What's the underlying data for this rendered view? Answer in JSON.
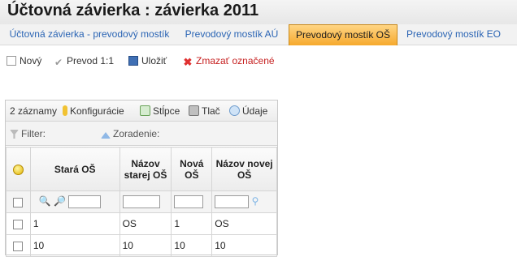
{
  "page": {
    "title": "Účtovná závierka :  závierka 2011"
  },
  "tabs": [
    {
      "label": "Účtovná závierka - prevodový mostík",
      "active": false
    },
    {
      "label": "Prevodový mostík AÚ",
      "active": false
    },
    {
      "label": "Prevodový mostík OŠ",
      "active": true
    },
    {
      "label": "Prevodový mostík EO",
      "active": false
    }
  ],
  "toolbar": {
    "new_label": "Nový",
    "convert_label": "Prevod 1:1",
    "save_label": "Uložiť",
    "delete_label": "Zmazať označené"
  },
  "grid": {
    "record_count": "2 záznamy",
    "config_label": "Konfigurácie",
    "columns_label": "Stĺpce",
    "print_label": "Tlač",
    "data_label": "Údaje",
    "filter_label": "Filter:",
    "sort_label": "Zoradenie:",
    "headers": [
      "Stará OŠ",
      "Názov starej OŠ",
      "Nová OŠ",
      "Názov novej OŠ"
    ],
    "rows": [
      [
        "1",
        "OS",
        "1",
        "OS"
      ],
      [
        "10",
        "10",
        "10",
        "10"
      ]
    ]
  }
}
